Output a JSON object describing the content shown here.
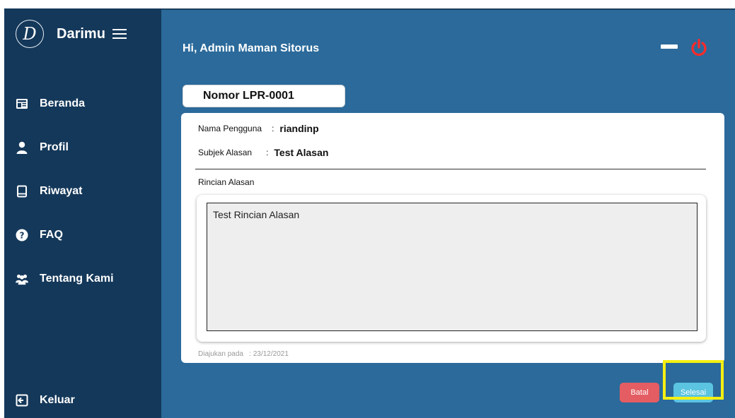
{
  "sidebar": {
    "logo_letter": "D",
    "brand_name": "Darimu",
    "items": [
      {
        "label": "Beranda",
        "icon": "newspaper-icon"
      },
      {
        "label": "Profil",
        "icon": "user-icon"
      },
      {
        "label": "Riwayat",
        "icon": "book-icon"
      },
      {
        "label": "FAQ",
        "icon": "question-circle-icon"
      },
      {
        "label": "Tentang Kami",
        "icon": "users-icon"
      }
    ],
    "logout_label": "Keluar"
  },
  "header": {
    "greeting": "Hi, Admin Maman Sitorus"
  },
  "report": {
    "nomor": "Nomor LPR-0001",
    "nama_label": "Nama Pengguna",
    "nama_value": "riandinp",
    "subjek_label": "Subjek Alasan",
    "subjek_value": "Test Alasan",
    "separator": ":",
    "rincian_label": "Rincian Alasan",
    "rincian_value": "Test Rincian Alasan",
    "diajukan_label": "Diajukan pada",
    "diajukan_value": "23/12/2021"
  },
  "actions": {
    "batal_label": "Batal",
    "selesai_label": "Selesai"
  },
  "colors": {
    "sidebar": "#14385a",
    "content": "#2b6a9b",
    "batal": "#e35d62",
    "selesai": "#5bc4e0",
    "power": "#ff2a2a",
    "highlight": "#f5ef12"
  }
}
